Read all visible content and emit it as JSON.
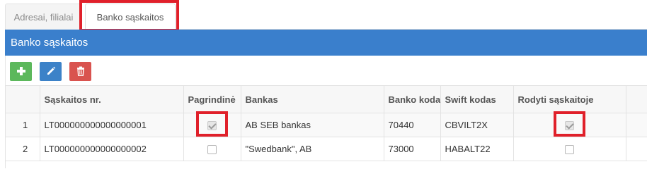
{
  "tabs": [
    {
      "label": "Adresai, filialai",
      "active": false
    },
    {
      "label": "Banko sąskaitos",
      "active": true
    }
  ],
  "panel": {
    "title": "Banko sąskaitos"
  },
  "toolbar": {
    "buttons": [
      {
        "name": "add",
        "icon": "plus-icon",
        "color": "#5cb85c"
      },
      {
        "name": "edit",
        "icon": "pencil-icon",
        "color": "#3c82c8"
      },
      {
        "name": "delete",
        "icon": "trash-icon",
        "color": "#d9534f"
      }
    ]
  },
  "table": {
    "columns": [
      "",
      "Sąskaitos nr.",
      "Pagrindinė",
      "Bankas",
      "Banko kodas",
      "Swift kodas",
      "Rodyti sąskaitoje",
      ""
    ],
    "rows": [
      {
        "index": "1",
        "account": "LT000000000000000001",
        "primary": true,
        "bank": "AB SEB bankas",
        "bank_code": "70440",
        "swift": "CBVILT2X",
        "show_on_invoice": true
      },
      {
        "index": "2",
        "account": "LT000000000000000002",
        "primary": false,
        "bank": "\"Swedbank\", AB",
        "bank_code": "73000",
        "swift": "HABALT22",
        "show_on_invoice": false
      }
    ]
  },
  "colors": {
    "header_blue": "#3a7fcc",
    "highlight_red": "#e0202a"
  }
}
